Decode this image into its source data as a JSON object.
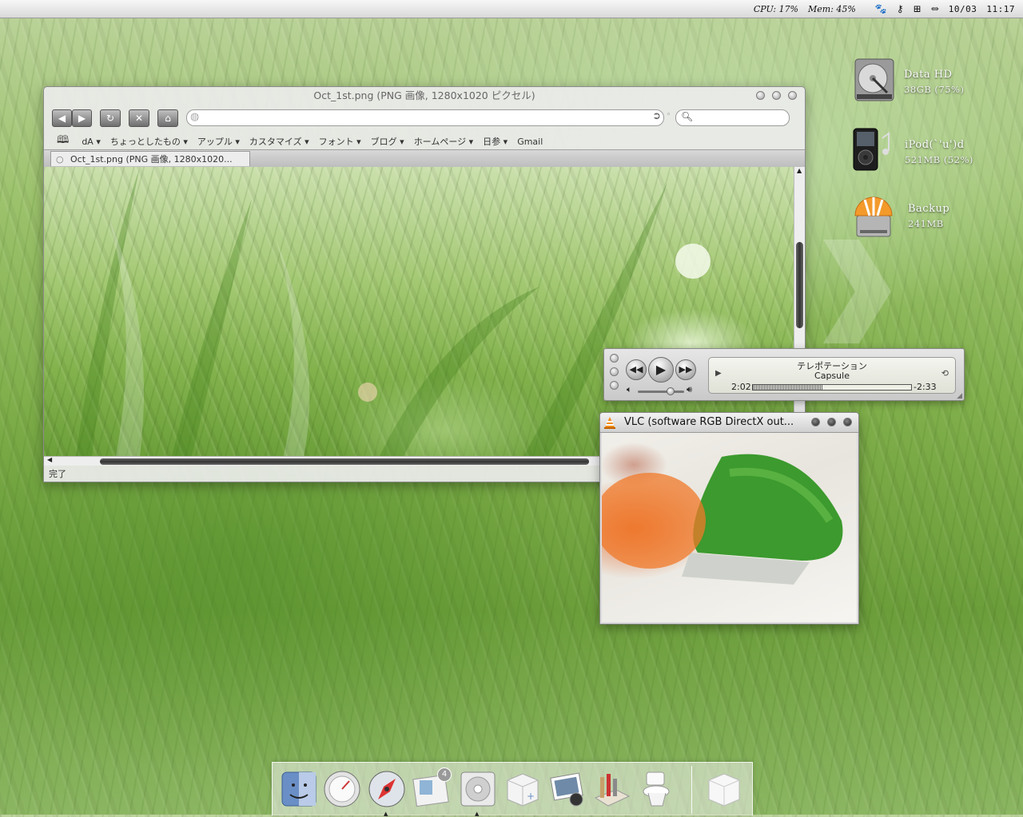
{
  "menubar": {
    "cpu_label": "CPU: 17%",
    "mem_label": "Mem: 45%",
    "date": "10/03",
    "time": "11:17"
  },
  "desktop_icons": [
    {
      "name": "Data HD",
      "detail": "38GB (75%)"
    },
    {
      "name": "iPod(`'u')d",
      "detail": "521MB (52%)"
    },
    {
      "name": "Backup",
      "detail": "241MB"
    }
  ],
  "desktop_watermark": "green",
  "browser": {
    "title": "Oct_1st.png (PNG 画像, 1280x1020 ピクセル)",
    "url": "",
    "search_placeholder": "",
    "bookmarks": [
      "dA ▾",
      "ちょっとしたもの ▾",
      "アップル ▾",
      "カスタマイズ ▾",
      "フォント ▾",
      "ブログ ▾",
      "ホームページ ▾",
      "日参 ▾",
      "Gmail"
    ],
    "tab_label": "Oct_1st.png (PNG 画像, 1280x1020...",
    "status": "完了"
  },
  "player": {
    "title_line": "テレポテーション",
    "artist_line": "Capsule",
    "elapsed": "2:02",
    "remaining": "-2:33",
    "progress": 0.44,
    "volume": 0.7
  },
  "vlc": {
    "title": "VLC (software RGB DirectX out..."
  },
  "dock": {
    "items": [
      "finder-icon",
      "dashboard-icon",
      "safari-icon",
      "mail-icon",
      "itunes-icon",
      "applications-icon",
      "iphoto-icon",
      "utilities-icon",
      "trash-icon",
      "box-icon"
    ],
    "mail_badge": "4"
  }
}
